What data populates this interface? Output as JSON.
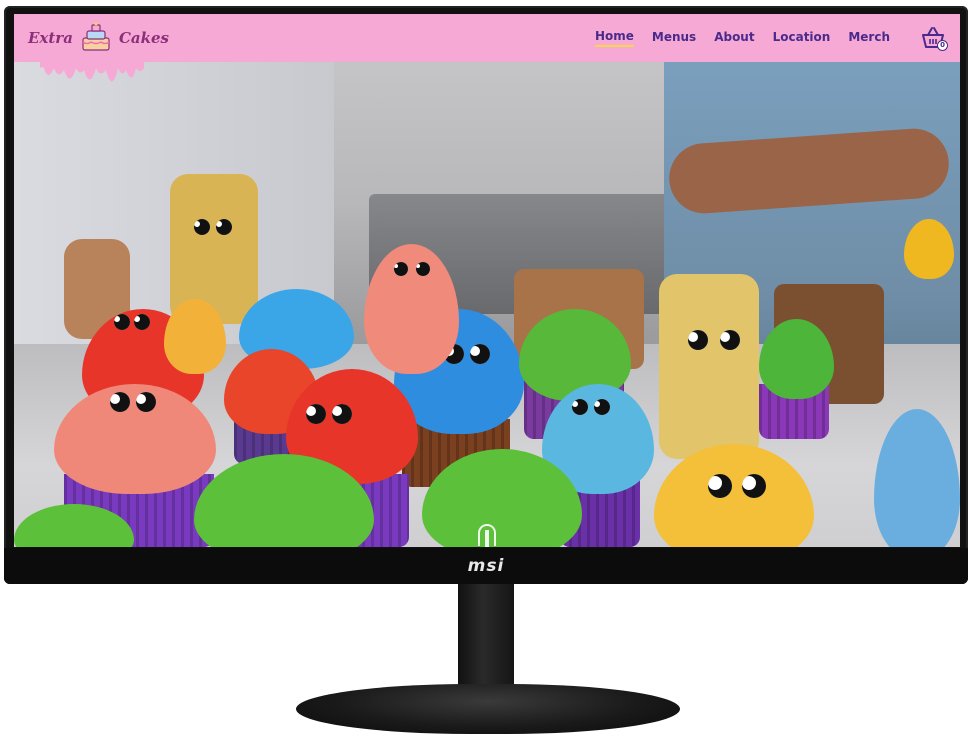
{
  "site": {
    "logo_text_left": "Extra",
    "logo_text_right": "Cakes"
  },
  "nav": {
    "items": [
      {
        "label": "Home",
        "active": true
      },
      {
        "label": "Menus",
        "active": false
      },
      {
        "label": "About",
        "active": false
      },
      {
        "label": "Location",
        "active": false
      },
      {
        "label": "Merch",
        "active": false
      }
    ],
    "cart_count": "0",
    "cart_icon": "shopping-basket-icon"
  },
  "hero": {
    "image_subject": "monster-cupcakes-photo"
  },
  "monitor": {
    "brand": "msi"
  },
  "colors": {
    "navbar_bg": "#f7a9d5",
    "nav_text": "#4a2b8c",
    "active_underline": "#f5d84a",
    "logo_text": "#8a2f7a"
  }
}
